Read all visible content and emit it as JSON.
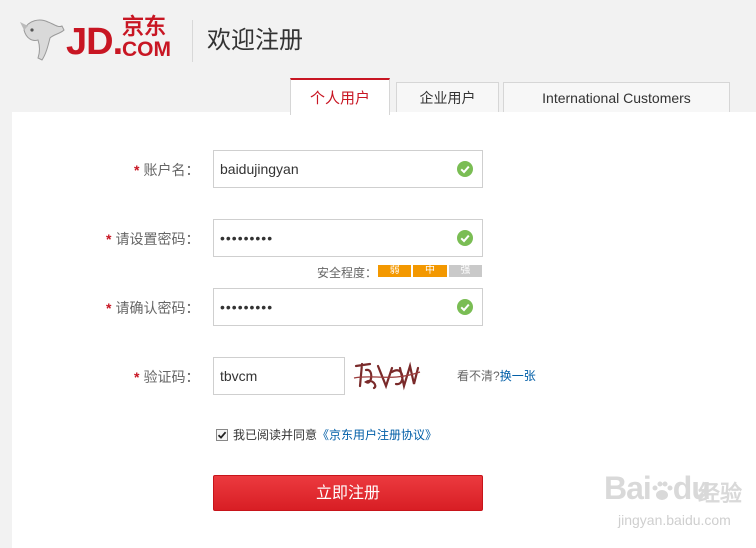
{
  "header": {
    "logo_jd": "JD.",
    "logo_cn": "京东",
    "logo_com": "COM",
    "title": "欢迎注册"
  },
  "tabs": [
    {
      "label": "个人用户",
      "active": true
    },
    {
      "label": "企业用户",
      "active": false
    },
    {
      "label": "International Customers",
      "active": false
    }
  ],
  "form": {
    "required_mark": "*",
    "username": {
      "label": "账户名：",
      "value": "baidujingyan",
      "status": "valid"
    },
    "password": {
      "label": "请设置密码：",
      "value": "•••••••••",
      "status": "valid"
    },
    "strength": {
      "label": "安全程度：",
      "levels": [
        "弱",
        "中",
        "强"
      ],
      "current_level": 2
    },
    "confirm_password": {
      "label": "请确认密码：",
      "value": "•••••••••",
      "status": "valid"
    },
    "captcha": {
      "label": "验证码：",
      "value": "tbvcm",
      "hint": "看不清?",
      "refresh": "换一张"
    },
    "agreement": {
      "checked": true,
      "text": "我已阅读并同意",
      "link": "《京东用户注册协议》"
    },
    "submit_label": "立即注册"
  },
  "watermark": {
    "main": "Bai",
    "paw": "du",
    "cn": "经验",
    "sub": "jingyan.baidu.com"
  },
  "colors": {
    "brand": "#c81623",
    "valid": "#7abd54",
    "strength": "#f39800",
    "link": "#005ea7"
  }
}
